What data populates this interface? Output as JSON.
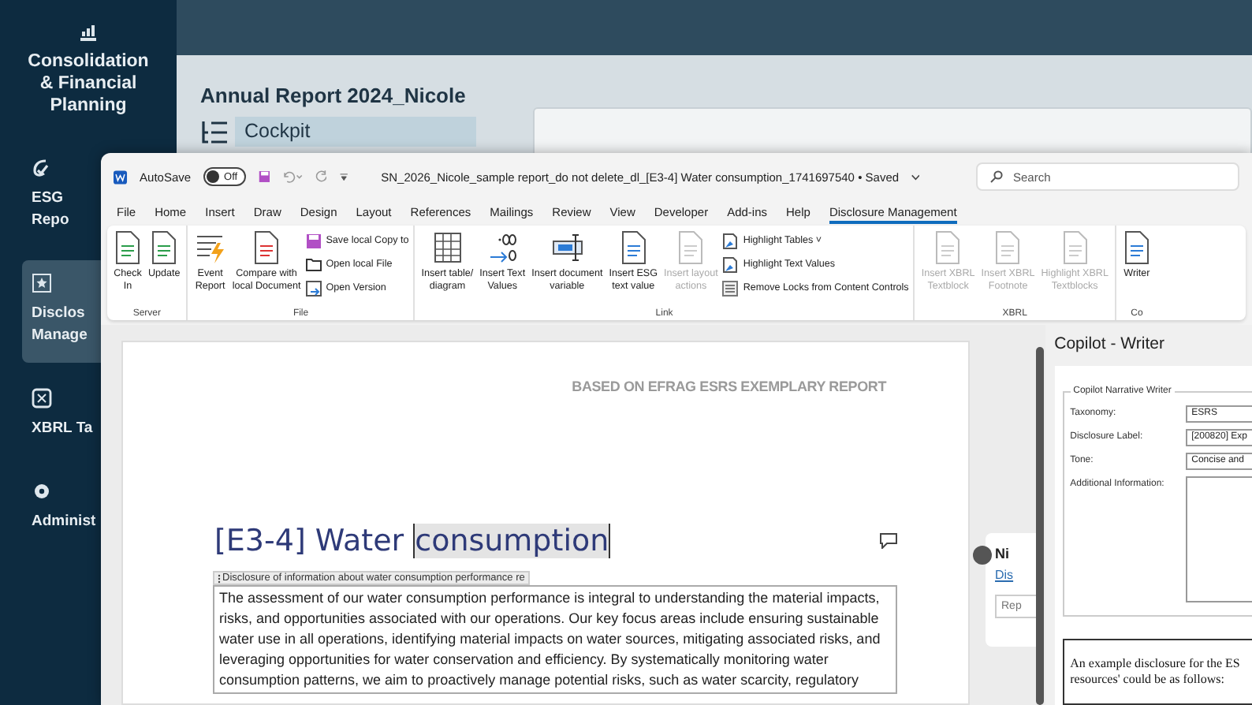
{
  "sidebar": {
    "items": [
      {
        "label": "Consolidation & Financial Planning",
        "selected": false,
        "clipped": false
      },
      {
        "label": "ESG Repo",
        "selected": false,
        "clipped": true
      },
      {
        "label": "Disclos Manage",
        "selected": true,
        "clipped": true
      },
      {
        "label": "XBRL Ta",
        "selected": false,
        "clipped": true
      },
      {
        "label": "Administ",
        "selected": false,
        "clipped": true
      }
    ]
  },
  "app": {
    "title": "Annual Report 2024_Nicole",
    "nav_item": "Cockpit"
  },
  "word": {
    "autosave_label": "AutoSave",
    "autosave_on": false,
    "autosave_state": "Off",
    "doc_title": "SN_2026_Nicole_sample report_do not delete_dl_[E3-4] Water consumption_1741697540",
    "save_status": "• Saved",
    "search_placeholder": "Search",
    "tabs": [
      {
        "label": "File",
        "selected": false
      },
      {
        "label": "Home",
        "selected": false
      },
      {
        "label": "Insert",
        "selected": false
      },
      {
        "label": "Draw",
        "selected": false
      },
      {
        "label": "Design",
        "selected": false
      },
      {
        "label": "Layout",
        "selected": false
      },
      {
        "label": "References",
        "selected": false
      },
      {
        "label": "Mailings",
        "selected": false
      },
      {
        "label": "Review",
        "selected": false
      },
      {
        "label": "View",
        "selected": false
      },
      {
        "label": "Developer",
        "selected": false
      },
      {
        "label": "Add-ins",
        "selected": false
      },
      {
        "label": "Help",
        "selected": false
      },
      {
        "label": "Disclosure Management",
        "selected": true
      }
    ],
    "ribbon_groups": [
      {
        "label": "Server",
        "buttons": [
          {
            "kind": "large",
            "lines": [
              "Check",
              "In"
            ],
            "disabled": false
          },
          {
            "kind": "large",
            "lines": [
              "Update"
            ],
            "disabled": false
          }
        ]
      },
      {
        "label": "File",
        "buttons": [
          {
            "kind": "large",
            "lines": [
              "Event",
              "Report"
            ],
            "disabled": false
          },
          {
            "kind": "large",
            "lines": [
              "Compare with",
              "local Document"
            ],
            "disabled": false
          },
          {
            "kind": "small",
            "lines": [
              "Save local Copy to"
            ],
            "disabled": false
          },
          {
            "kind": "small",
            "lines": [
              "Open local File"
            ],
            "disabled": false
          },
          {
            "kind": "small",
            "lines": [
              "Open Version"
            ],
            "disabled": false
          }
        ]
      },
      {
        "label": "Link",
        "buttons": [
          {
            "kind": "large",
            "lines": [
              "Insert table/",
              "diagram"
            ],
            "disabled": false
          },
          {
            "kind": "large",
            "lines": [
              "Insert Text",
              "Values"
            ],
            "disabled": false
          },
          {
            "kind": "large",
            "lines": [
              "Insert document",
              "variable"
            ],
            "disabled": false
          },
          {
            "kind": "large",
            "lines": [
              "Insert ESG",
              "text value"
            ],
            "disabled": false
          },
          {
            "kind": "large",
            "lines": [
              "Insert layout",
              "actions"
            ],
            "disabled": true
          },
          {
            "kind": "small",
            "lines": [
              "Highlight Tables ˅"
            ],
            "disabled": false
          },
          {
            "kind": "small",
            "lines": [
              "Highlight Text Values"
            ],
            "disabled": false
          },
          {
            "kind": "small",
            "lines": [
              "Remove Locks from Content Controls"
            ],
            "disabled": false
          }
        ]
      },
      {
        "label": "XBRL",
        "buttons": [
          {
            "kind": "large",
            "lines": [
              "Insert XBRL",
              "Textblock"
            ],
            "disabled": true
          },
          {
            "kind": "large",
            "lines": [
              "Insert XBRL",
              "Footnote"
            ],
            "disabled": true
          },
          {
            "kind": "large",
            "lines": [
              "Highlight XBRL",
              "Textblocks"
            ],
            "disabled": true
          }
        ]
      },
      {
        "label": "Co",
        "buttons": [
          {
            "kind": "large",
            "lines": [
              "Writer"
            ],
            "disabled": false
          }
        ]
      }
    ]
  },
  "document": {
    "header": "BASED ON EFRAG ESRS EXEMPLARY REPORT",
    "heading": "[E3-4] Water",
    "heading_selected": "consumption",
    "control_tag": "Disclosure of information about water consumption performance re",
    "paragraph_lines": [
      "The assessment of our water consumption performance is integral to understanding the material impacts,",
      "risks, and opportunities associated with our operations. Our key focus areas include ensuring sustainable",
      "water use in all operations, identifying material impacts on water sources, mitigating associated risks, and",
      "leveraging opportunities for water conservation and efficiency. By systematically monitoring water",
      "consumption patterns, we aim to proactively manage potential risks, such as water scarcity, regulatory"
    ]
  },
  "comment": {
    "author": "Ni",
    "link": "Dis",
    "reply_placeholder": "Rep"
  },
  "copilot": {
    "title": "Copilot - Writer",
    "group_title": "Copilot Narrative Writer",
    "fields": [
      {
        "kind": "select",
        "label": "Taxonomy:",
        "value": "ESRS"
      },
      {
        "kind": "select",
        "label": "Disclosure Label:",
        "value": "[200820] Exp"
      },
      {
        "kind": "select",
        "label": "Tone:",
        "value": "Concise and"
      },
      {
        "kind": "textarea",
        "label": "Additional Information:"
      }
    ],
    "output_lines": [
      "An example disclosure for the ES",
      "resources' could be as follows:"
    ]
  }
}
